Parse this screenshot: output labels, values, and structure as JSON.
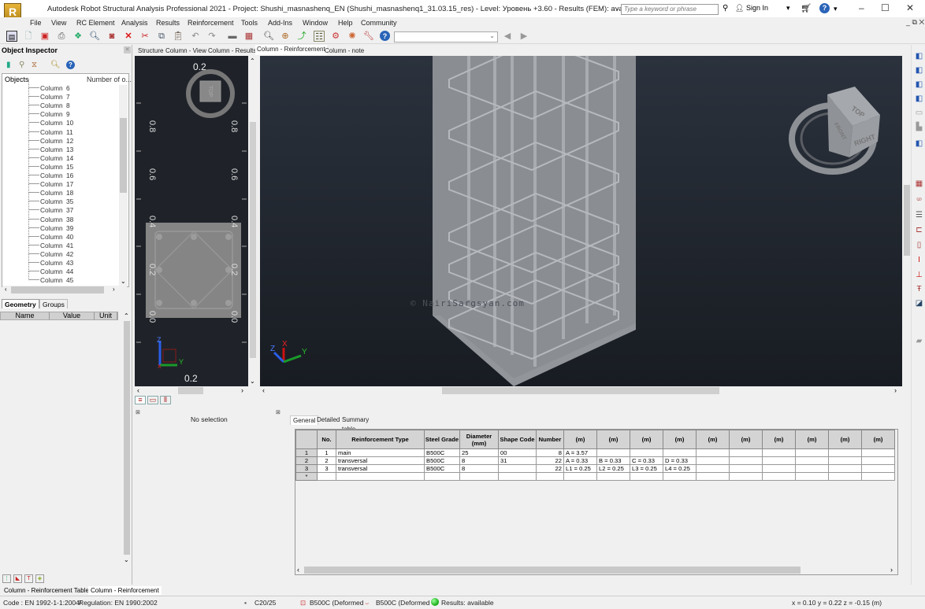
{
  "window": {
    "title": "Autodesk Robot Structural Analysis Professional 2021 - Project: Shushi_masnashenq_EN (Shushi_masnashenq1_31.03.15_res) - Level: Уровень +3.60 - Results (FEM): available - Results: available",
    "logo": "R",
    "logo_sub": "PRO",
    "search_placeholder": "Type a keyword or phrase",
    "sign_in": "Sign In",
    "minimize": "–",
    "maximize": "☐",
    "close": "✕",
    "mdi_controls": "_ ⧉ ✕"
  },
  "menu": [
    "File",
    "View",
    "RC Element",
    "Analysis",
    "Results",
    "Reinforcement",
    "Tools",
    "Add-Ins",
    "Window",
    "Help",
    "Community"
  ],
  "toolbar": {
    "combo_value": "",
    "icons": [
      "structure-icon",
      "new-icon",
      "save-icon",
      "print-icon",
      "print-preview-icon",
      "preview-icon",
      "screen-capture-icon",
      "delete-icon",
      "cut-icon",
      "copy-icon",
      "paste-icon",
      "undo-icon",
      "redo-icon",
      "display-icon",
      "tables-icon",
      "zoom-icon",
      "zoom-window-icon",
      "select-icon",
      "properties-icon",
      "calc-icon",
      "settings-icon",
      "preferences-icon",
      "help-icon"
    ]
  },
  "object_inspector": {
    "title": "Object Inspector",
    "columns": {
      "objects": "Objects",
      "number": "Number of o..."
    },
    "items": [
      {
        "label": "Column",
        "num": "6"
      },
      {
        "label": "Column",
        "num": "7"
      },
      {
        "label": "Column",
        "num": "8"
      },
      {
        "label": "Column",
        "num": "9"
      },
      {
        "label": "Column",
        "num": "10"
      },
      {
        "label": "Column",
        "num": "11"
      },
      {
        "label": "Column",
        "num": "12"
      },
      {
        "label": "Column",
        "num": "13"
      },
      {
        "label": "Column",
        "num": "14"
      },
      {
        "label": "Column",
        "num": "15"
      },
      {
        "label": "Column",
        "num": "16"
      },
      {
        "label": "Column",
        "num": "17"
      },
      {
        "label": "Column",
        "num": "18"
      },
      {
        "label": "Column",
        "num": "35"
      },
      {
        "label": "Column",
        "num": "37"
      },
      {
        "label": "Column",
        "num": "38"
      },
      {
        "label": "Column",
        "num": "39"
      },
      {
        "label": "Column",
        "num": "40"
      },
      {
        "label": "Column",
        "num": "41"
      },
      {
        "label": "Column",
        "num": "42"
      },
      {
        "label": "Column",
        "num": "43"
      },
      {
        "label": "Column",
        "num": "44"
      },
      {
        "label": "Column",
        "num": "45"
      }
    ],
    "tabs": [
      "Geometry",
      "Groups"
    ],
    "prop_columns": [
      "Name",
      "Value",
      "Unit"
    ]
  },
  "view_tabs": [
    {
      "label": "Structure",
      "active": false
    },
    {
      "label": "Column - View",
      "active": false
    },
    {
      "label": "Column - Results",
      "active": false
    },
    {
      "label": "Column - Reinforcement",
      "active": true
    },
    {
      "label": "Column - note",
      "active": false
    }
  ],
  "section_view": {
    "top_label": "0.2",
    "bottom_label": "0.2",
    "ruler_labels": [
      "0.8",
      "0.6",
      "0.4",
      "0.2",
      "0.0"
    ],
    "viewcube_face": "TOP",
    "axes": {
      "z": "Z",
      "y": "Y",
      "x": "X"
    }
  },
  "view3d": {
    "watermark": "© NairiSargsyan.com",
    "viewcube": {
      "top": "TOP",
      "front": "FRONT",
      "right": "RIGHT"
    },
    "axes": {
      "z": "Z",
      "x": "X",
      "y": "Y"
    }
  },
  "selection_panel": {
    "text": "No selection"
  },
  "result_tabs": [
    {
      "label": "General",
      "active": true
    },
    {
      "label": "Detailed",
      "active": false
    },
    {
      "label": "Summary table",
      "active": false
    }
  ],
  "table": {
    "headers": [
      "",
      "No.",
      "Reinforcement Type",
      "Steel Grade",
      "Diameter (mm)",
      "Shape Code",
      "Number",
      "(m)",
      "(m)",
      "(m)",
      "(m)",
      "(m)",
      "(m)",
      "(m)",
      "(m)",
      "(m)",
      "(m)"
    ],
    "rows": [
      {
        "rh": "1",
        "no": "1",
        "type": "main",
        "grade": "B500C",
        "dia": "25",
        "shape": "00",
        "number": "8",
        "m": [
          "A = 3.57",
          "",
          "",
          "",
          "",
          "",
          "",
          "",
          "",
          ""
        ]
      },
      {
        "rh": "2",
        "no": "2",
        "type": "transversal",
        "grade": "B500C",
        "dia": "8",
        "shape": "31",
        "number": "22",
        "m": [
          "A = 0.33",
          "B = 0.33",
          "C = 0.33",
          "D = 0.33",
          "",
          "",
          "",
          "",
          "",
          ""
        ]
      },
      {
        "rh": "3",
        "no": "3",
        "type": "transversal",
        "grade": "B500C",
        "dia": "8",
        "shape": "",
        "number": "22",
        "m": [
          "L1 = 0.25",
          "L2 = 0.25",
          "L3 = 0.25",
          "L4 = 0.25",
          "",
          "",
          "",
          "",
          "",
          ""
        ]
      },
      {
        "rh": "*",
        "no": "",
        "type": "",
        "grade": "",
        "dia": "",
        "shape": "",
        "number": "",
        "m": [
          "",
          "",
          "",
          "",
          "",
          "",
          "",
          "",
          "",
          ""
        ]
      }
    ]
  },
  "bottom_tabs": [
    {
      "label": "Column - Reinforcement Table",
      "active": false
    },
    {
      "label": "Column - Reinforcement",
      "active": true
    }
  ],
  "status": {
    "code": "Code : EN 1992-1-1:2004/",
    "regulation": "Regulation: EN 1990:2002",
    "concrete": "C20/25",
    "steel1": "B500C (Deformed",
    "steel2": "B500C (Deformed",
    "results": "Results: available",
    "coords": "x = 0.10 y = 0.22 z = -0.15   (m)",
    "results_color": "#22bb22"
  }
}
